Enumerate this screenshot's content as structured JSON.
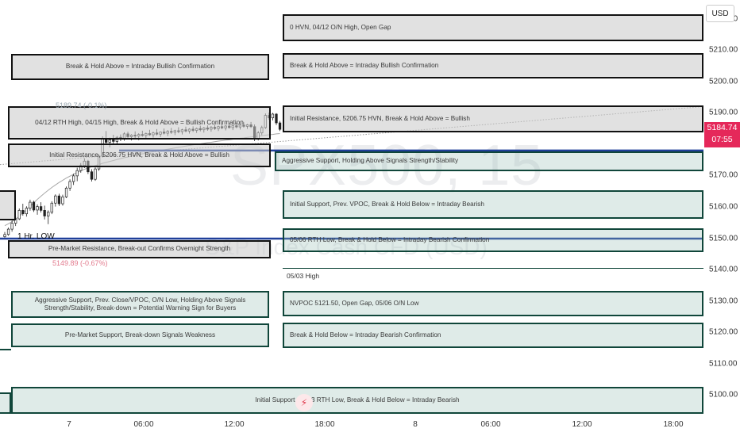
{
  "watermark": {
    "symbol": "SPX500, 15",
    "name": "S&P Index Cash CFD (USD)"
  },
  "currency": "USD",
  "last_price": {
    "price": "5184.74",
    "countdown": "07:55",
    "color": "#e5285a"
  },
  "annotations": {
    "high_label": "5189.74 (-0.1%)",
    "low_label": "5149.89 (-0.67%)",
    "one_hr_low": "1 Hr. LOW",
    "may03_high": "05/03 High"
  },
  "zones": [
    {
      "id": "hvn-0412-on-high",
      "label": "0 HVN, 04/12 O/N High, Open Gap",
      "kind": "res",
      "align": "left"
    },
    {
      "id": "break-hold-above-left",
      "label": "Break & Hold Above = Intraday Bullish Confirmation",
      "kind": "res",
      "align": "center"
    },
    {
      "id": "break-hold-above-right",
      "label": "Break & Hold Above = Intraday Bullish Confirmation",
      "kind": "res",
      "align": "left"
    },
    {
      "id": "rth-high-0412",
      "label": "04/12 RTH High, 04/15 High, Break & Hold Above = Bullish Confirmation",
      "kind": "res",
      "align": "center"
    },
    {
      "id": "initial-resistance-right",
      "label": "Initial Resistance, 5206.75 HVN, Break & Hold Above = Bullish",
      "kind": "res",
      "align": "left"
    },
    {
      "id": "initial-resistance-left",
      "label": "Initial Resistance, 5206.75 HVN, Break & Hold Above = Bullish",
      "kind": "res",
      "align": "center"
    },
    {
      "id": "aggressive-support-top",
      "label": "Aggressive Support, Holding Above Signals Strength/Stability",
      "kind": "sup",
      "align": "left"
    },
    {
      "id": "initial-support-vpoc",
      "label": "Initial Support, Prev. VPOC, Break & Hold Below = Intraday Bearish",
      "kind": "sup",
      "align": "left"
    },
    {
      "id": "rth-low-0506",
      "label": "05/06 RTH Low, Break & Hold Below = Intraday Bearish Confirmation",
      "kind": "sup",
      "align": "left"
    },
    {
      "id": "pre-market-resistance",
      "label": "Pre-Market Resistance, Break-out Confirms Overnight Strength",
      "kind": "res",
      "align": "center"
    },
    {
      "id": "aggressive-support-prev-close",
      "label": "Aggressive Support, Prev. Close/VPOC, O/N Low, Holding Above Signals Strength/Stability, Break-down = Potential Warning Sign for Buyers",
      "kind": "sup",
      "align": "center"
    },
    {
      "id": "nvpoc-5121",
      "label": "NVPOC 5121.50, Open Gap, 05/06 O/N Low",
      "kind": "sup",
      "align": "left"
    },
    {
      "id": "pre-market-support",
      "label": "Pre-Market Support, Break-down Signals Weakness",
      "kind": "sup",
      "align": "center"
    },
    {
      "id": "break-hold-below-right",
      "label": "Break & Hold Below = Intraday Bearish Confirmation",
      "kind": "sup",
      "align": "left"
    },
    {
      "id": "initial-support-0503",
      "label": "Initial Support, 05/03 RTH Low, Break & Hold Below = Intraday Bearish",
      "kind": "sup",
      "align": "center"
    }
  ],
  "chart_data": {
    "type": "candlestick",
    "title": "SPX500, 15",
    "subtitle": "S&P Index Cash CFD (USD)",
    "ylim": [
      5094,
      5226
    ],
    "y_ticks": [
      5100,
      5110,
      5120,
      5130,
      5140,
      5150,
      5160,
      5170,
      5180,
      5190,
      5200,
      5210,
      5220
    ],
    "x_ticks": [
      "7",
      "06:00",
      "12:00",
      "18:00",
      "8",
      "06:00",
      "12:00",
      "18:00"
    ],
    "grid": false,
    "series": [
      {
        "type": "candles",
        "ohlc": [
          [
            5150.5,
            5152.0,
            5149.9,
            5151.2
          ],
          [
            5151.2,
            5153.4,
            5150.8,
            5152.9
          ],
          [
            5152.9,
            5155.6,
            5152.1,
            5154.8
          ],
          [
            5154.8,
            5157.0,
            5153.9,
            5156.2
          ],
          [
            5156.2,
            5159.5,
            5155.8,
            5158.9
          ],
          [
            5158.9,
            5161.0,
            5157.2,
            5157.8
          ],
          [
            5157.8,
            5160.2,
            5156.9,
            5159.6
          ],
          [
            5159.6,
            5162.3,
            5158.8,
            5161.5
          ],
          [
            5161.5,
            5162.0,
            5158.4,
            5159.0
          ],
          [
            5159.0,
            5160.8,
            5157.5,
            5160.1
          ],
          [
            5160.1,
            5161.5,
            5158.2,
            5158.9
          ],
          [
            5158.9,
            5160.4,
            5156.0,
            5157.1
          ],
          [
            5157.1,
            5158.9,
            5154.5,
            5158.3
          ],
          [
            5158.3,
            5161.8,
            5157.7,
            5161.2
          ],
          [
            5161.2,
            5164.0,
            5160.1,
            5163.5
          ],
          [
            5163.5,
            5164.2,
            5160.3,
            5161.0
          ],
          [
            5161.0,
            5163.9,
            5160.4,
            5163.2
          ],
          [
            5163.2,
            5166.5,
            5162.8,
            5166.0
          ],
          [
            5166.0,
            5168.8,
            5165.1,
            5168.1
          ],
          [
            5168.1,
            5170.6,
            5167.0,
            5169.9
          ],
          [
            5169.9,
            5172.5,
            5168.2,
            5171.6
          ],
          [
            5171.6,
            5174.0,
            5170.9,
            5173.2
          ],
          [
            5173.2,
            5175.5,
            5172.4,
            5174.6
          ],
          [
            5174.6,
            5175.0,
            5170.5,
            5171.2
          ],
          [
            5171.2,
            5172.0,
            5168.1,
            5168.8
          ],
          [
            5168.8,
            5172.6,
            5168.3,
            5172.1
          ],
          [
            5172.1,
            5176.8,
            5171.5,
            5176.2
          ],
          [
            5176.2,
            5182.5,
            5175.8,
            5181.9
          ],
          [
            5181.9,
            5184.2,
            5179.8,
            5180.6
          ],
          [
            5180.6,
            5182.1,
            5179.0,
            5181.4
          ],
          [
            5181.4,
            5183.0,
            5180.2,
            5180.9
          ],
          [
            5180.9,
            5182.6,
            5180.1,
            5182.2
          ],
          [
            5182.2,
            5183.1,
            5181.0,
            5181.6
          ],
          [
            5181.6,
            5183.8,
            5181.1,
            5183.3
          ],
          [
            5183.3,
            5184.0,
            5181.9,
            5182.4
          ],
          [
            5182.4,
            5183.2,
            5181.2,
            5182.9
          ],
          [
            5182.9,
            5184.1,
            5182.0,
            5182.6
          ],
          [
            5182.6,
            5183.5,
            5181.3,
            5183.1
          ],
          [
            5183.1,
            5184.3,
            5182.4,
            5182.8
          ],
          [
            5182.8,
            5183.7,
            5181.9,
            5183.4
          ],
          [
            5183.4,
            5184.6,
            5182.7,
            5183.0
          ],
          [
            5183.0,
            5184.0,
            5182.1,
            5183.6
          ],
          [
            5183.6,
            5184.8,
            5182.8,
            5183.2
          ],
          [
            5183.2,
            5184.1,
            5182.3,
            5183.9
          ],
          [
            5183.9,
            5185.0,
            5183.1,
            5183.5
          ],
          [
            5183.5,
            5184.5,
            5182.6,
            5184.1
          ],
          [
            5184.1,
            5185.2,
            5183.3,
            5183.8
          ],
          [
            5183.8,
            5184.6,
            5182.9,
            5184.3
          ],
          [
            5184.3,
            5185.4,
            5183.5,
            5184.0
          ],
          [
            5184.0,
            5184.9,
            5183.1,
            5184.6
          ],
          [
            5184.6,
            5185.6,
            5183.8,
            5184.2
          ],
          [
            5184.2,
            5185.1,
            5183.4,
            5184.8
          ],
          [
            5184.8,
            5185.7,
            5183.9,
            5184.4
          ],
          [
            5184.4,
            5185.3,
            5183.6,
            5185.0
          ],
          [
            5185.0,
            5185.9,
            5184.1,
            5184.6
          ],
          [
            5184.6,
            5185.5,
            5183.7,
            5185.2
          ],
          [
            5185.2,
            5186.0,
            5184.3,
            5184.8
          ],
          [
            5184.8,
            5185.8,
            5184.0,
            5185.4
          ],
          [
            5185.4,
            5186.2,
            5184.6,
            5185.0
          ],
          [
            5185.0,
            5185.9,
            5184.2,
            5185.6
          ],
          [
            5185.6,
            5186.4,
            5184.8,
            5185.2
          ],
          [
            5185.2,
            5186.1,
            5184.4,
            5185.8
          ],
          [
            5185.8,
            5186.6,
            5185.0,
            5185.3
          ],
          [
            5185.3,
            5186.2,
            5184.5,
            5185.9
          ],
          [
            5185.9,
            5186.8,
            5185.1,
            5185.5
          ],
          [
            5185.5,
            5186.4,
            5184.7,
            5186.1
          ],
          [
            5186.1,
            5187.0,
            5185.3,
            5185.7
          ],
          [
            5185.7,
            5186.5,
            5184.9,
            5186.2
          ],
          [
            5186.2,
            5187.1,
            5185.2,
            5185.6
          ],
          [
            5185.6,
            5186.3,
            5181.0,
            5181.8
          ],
          [
            5181.8,
            5184.2,
            5181.2,
            5183.6
          ],
          [
            5183.6,
            5185.9,
            5182.9,
            5185.3
          ],
          [
            5185.3,
            5189.8,
            5184.9,
            5189.2
          ],
          [
            5189.2,
            5190.1,
            5187.8,
            5188.4
          ],
          [
            5188.4,
            5190.0,
            5187.6,
            5189.6
          ],
          [
            5189.6,
            5189.9,
            5186.1,
            5186.8
          ],
          [
            5186.8,
            5187.4,
            5184.2,
            5184.74
          ]
        ]
      },
      {
        "type": "moving-average",
        "values": [
          5154.0,
          5154.6,
          5155.3,
          5156.1,
          5157.0,
          5158.0,
          5159.1,
          5160.2,
          5161.3,
          5162.4,
          5163.4,
          5164.4,
          5165.3,
          5166.2,
          5167.0,
          5167.8,
          5168.5,
          5169.2,
          5169.8,
          5170.4,
          5171.0,
          5171.5,
          5172.0,
          5172.4,
          5172.8,
          5173.2,
          5173.5,
          5173.9,
          5174.2,
          5174.5,
          5174.8,
          5175.1,
          5175.4,
          5175.7,
          5175.9,
          5176.2,
          5176.4,
          5176.7,
          5176.9,
          5177.1,
          5177.4,
          5177.6,
          5177.8,
          5178.0,
          5178.2,
          5178.4,
          5178.6,
          5178.8,
          5179.0,
          5179.2,
          5179.4,
          5179.6,
          5179.8,
          5180.0,
          5180.1,
          5180.3,
          5180.5,
          5180.6,
          5180.8,
          5181.0,
          5181.1,
          5181.3,
          5181.4,
          5181.6,
          5181.7,
          5181.9,
          5182.0,
          5182.2,
          5182.3,
          5182.4,
          5182.6,
          5182.7,
          5182.9,
          5183.0,
          5183.1,
          5183.3,
          5183.4
        ]
      },
      {
        "type": "trendline-dotted",
        "points": [
          [
            0,
            5173.5
          ],
          [
            1,
            5192.0
          ]
        ]
      },
      {
        "type": "horizontal-level",
        "values": [
          5178.0,
          5149.9
        ],
        "color": "#1f3f9a"
      }
    ],
    "zone_ranges": [
      [
        5214.0,
        5222.5
      ],
      [
        5198.5,
        5207.0
      ],
      [
        5198.5,
        5207.0
      ],
      [
        5187.0,
        5193.5
      ],
      [
        5187.0,
        5193.5
      ],
      [
        5175.5,
        5183.0
      ],
      [
        5173.5,
        5178.5
      ],
      [
        5158.5,
        5166.5
      ],
      [
        5148.5,
        5154.0
      ],
      [
        5146.5,
        5151.5
      ],
      [
        5127.0,
        5134.0
      ],
      [
        5127.0,
        5134.0
      ],
      [
        5116.5,
        5123.0
      ],
      [
        5116.5,
        5124.0
      ],
      [
        5094.0,
        5103.5
      ]
    ]
  }
}
